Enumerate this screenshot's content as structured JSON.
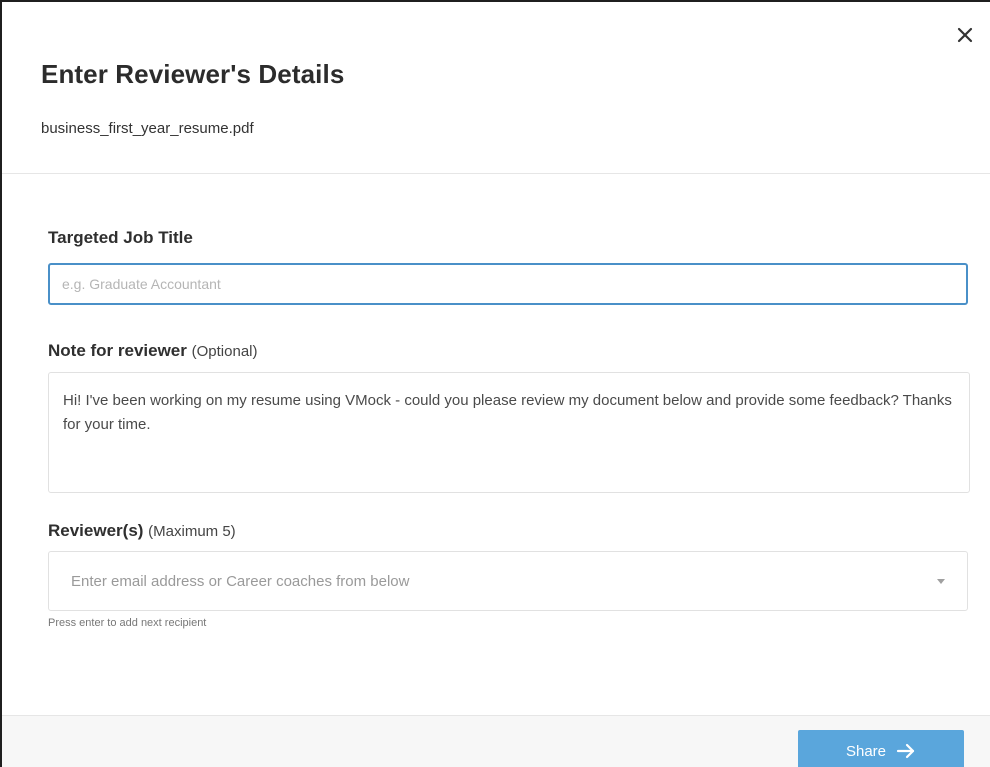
{
  "modal": {
    "title": "Enter Reviewer's Details",
    "filename": "business_first_year_resume.pdf",
    "close_icon": "close-icon"
  },
  "job_title": {
    "label": "Targeted Job Title",
    "placeholder": "e.g. Graduate Accountant",
    "value": ""
  },
  "note": {
    "label": "Note for reviewer",
    "optional_label": "(Optional)",
    "value": "Hi! I've been working on my resume using VMock - could you please review my document below and provide some feedback? Thanks for your time."
  },
  "reviewers": {
    "label": "Reviewer(s)",
    "max_label": "(Maximum 5)",
    "placeholder": "Enter email address or Career coaches from below",
    "hint": "Press enter to add next recipient",
    "dropdown_icon": "caret-down-icon"
  },
  "footer": {
    "share_label": "Share",
    "share_icon": "arrow-right-icon",
    "accent_color": "#5aa6dc",
    "focus_color": "#4a90c8"
  }
}
